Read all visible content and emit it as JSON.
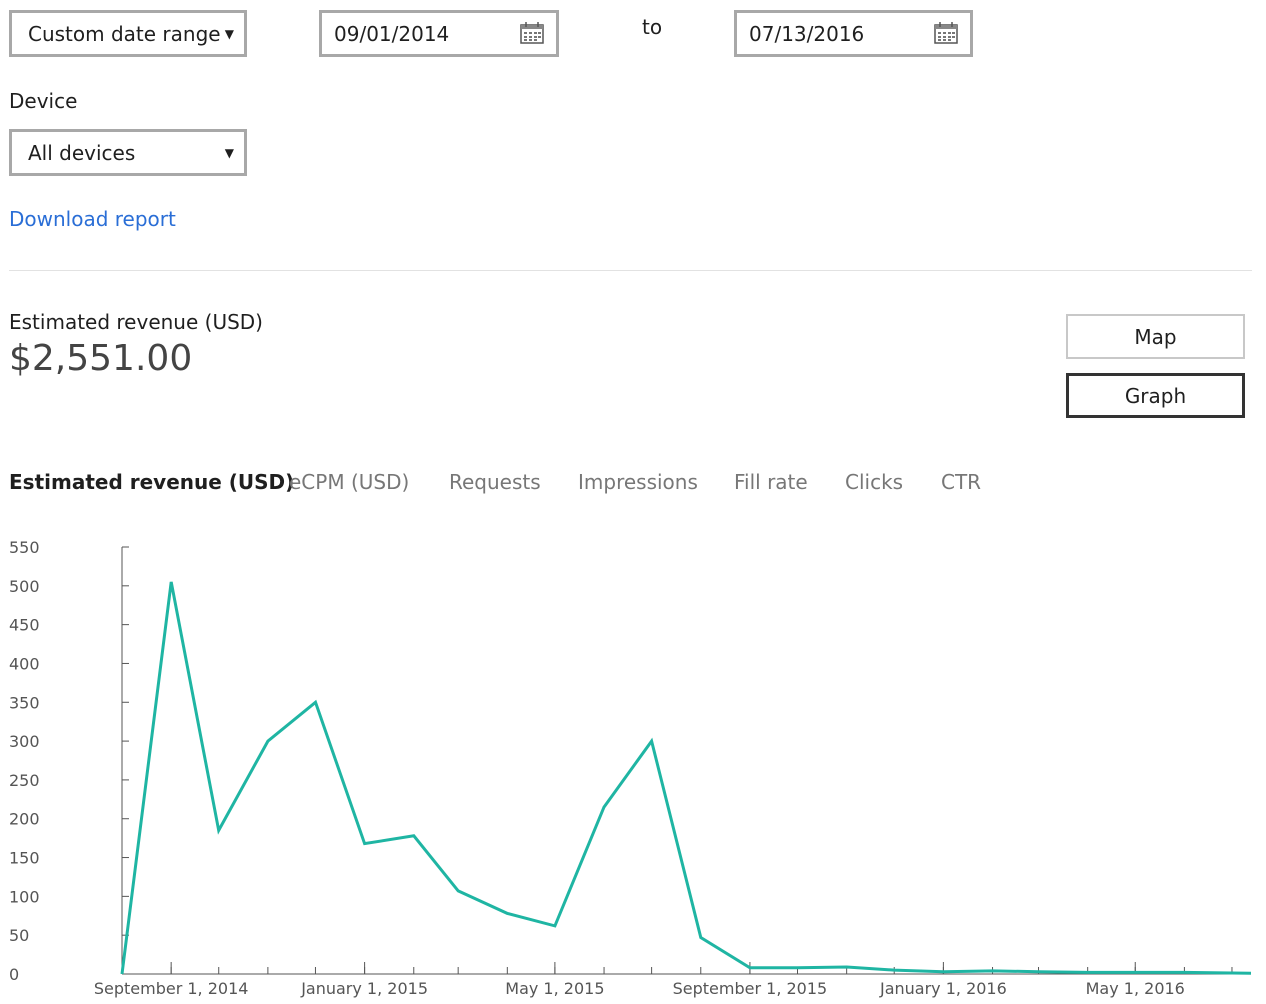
{
  "filters": {
    "date_range_select": "Custom date range",
    "start_date": "09/01/2014",
    "to_label": "to",
    "end_date": "07/13/2016",
    "device_label": "Device",
    "device_select": "All devices",
    "download_link": "Download report"
  },
  "summary": {
    "label": "Estimated revenue (USD)",
    "value": "$2,551.00"
  },
  "view_toggle": {
    "map_label": "Map",
    "graph_label": "Graph",
    "selected": "Graph"
  },
  "metric_tabs": [
    {
      "label": "Estimated revenue (USD)",
      "active": true
    },
    {
      "label": "eCPM (USD)",
      "active": false
    },
    {
      "label": "Requests",
      "active": false
    },
    {
      "label": "Impressions",
      "active": false
    },
    {
      "label": "Fill rate",
      "active": false
    },
    {
      "label": "Clicks",
      "active": false
    },
    {
      "label": "CTR",
      "active": false
    }
  ],
  "colors": {
    "line": "#1fb5a3",
    "link": "#2a6ed6",
    "axis": "#555555"
  },
  "chart_data": {
    "type": "line",
    "ylim": [
      0,
      550
    ],
    "yticks": [
      0,
      50,
      100,
      150,
      200,
      250,
      300,
      350,
      400,
      450,
      500,
      550
    ],
    "xlim": [
      "2014-08-01",
      "2016-07-13"
    ],
    "xtick_labels": [
      {
        "date": "2014-09-01",
        "label": "September 1, 2014"
      },
      {
        "date": "2015-01-01",
        "label": "January 1, 2015"
      },
      {
        "date": "2015-05-01",
        "label": "May 1, 2015"
      },
      {
        "date": "2015-09-01",
        "label": "September 1, 2015"
      },
      {
        "date": "2016-01-01",
        "label": "January 1, 2016"
      },
      {
        "date": "2016-05-01",
        "label": "May 1, 2016"
      }
    ],
    "minor_ticks": [
      "2014-08-01",
      "2014-09-01",
      "2014-10-01",
      "2014-11-01",
      "2014-12-01",
      "2015-01-01",
      "2015-02-01",
      "2015-03-01",
      "2015-04-01",
      "2015-05-01",
      "2015-06-01",
      "2015-07-01",
      "2015-08-01",
      "2015-09-01",
      "2015-10-01",
      "2015-11-01",
      "2015-12-01",
      "2016-01-01",
      "2016-02-01",
      "2016-03-01",
      "2016-04-01",
      "2016-05-01",
      "2016-06-01",
      "2016-07-01"
    ],
    "series": [
      {
        "x": [
          "2014-08-01",
          "2014-09-01",
          "2014-10-01",
          "2014-11-01",
          "2014-12-01",
          "2015-01-01",
          "2015-02-01",
          "2015-03-01",
          "2015-04-01",
          "2015-05-01",
          "2015-06-01",
          "2015-07-01",
          "2015-08-01",
          "2015-09-01",
          "2015-10-01",
          "2015-11-01",
          "2015-12-01",
          "2016-01-01",
          "2016-02-01",
          "2016-03-01",
          "2016-04-01",
          "2016-05-01",
          "2016-06-01",
          "2016-07-13"
        ],
        "y": [
          0,
          505,
          185,
          300,
          350,
          168,
          178,
          107,
          78,
          62,
          215,
          300,
          47,
          8,
          8,
          9,
          5,
          3,
          4,
          3,
          2,
          2,
          2,
          1
        ]
      }
    ]
  }
}
